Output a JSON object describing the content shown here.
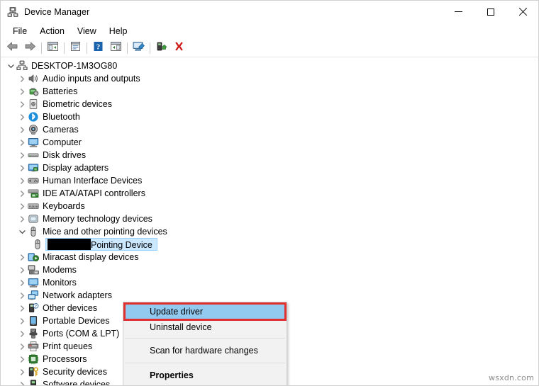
{
  "window": {
    "title": "Device Manager",
    "title_icon": "device-manager-icon",
    "controls": {
      "minimize": "minimize-icon",
      "maximize": "maximize-icon",
      "close": "close-icon"
    }
  },
  "menubar": {
    "items": [
      {
        "label": "File"
      },
      {
        "label": "Action"
      },
      {
        "label": "View"
      },
      {
        "label": "Help"
      }
    ]
  },
  "toolbar": {
    "buttons": [
      {
        "name": "back-icon"
      },
      {
        "name": "forward-icon"
      },
      {
        "name": "show-hide-console-tree-icon"
      },
      {
        "name": "properties-icon"
      },
      {
        "name": "help-icon"
      },
      {
        "name": "show-hide-action-pane-icon"
      },
      {
        "name": "scan-for-hardware-changes-icon"
      },
      {
        "name": "update-driver-icon"
      },
      {
        "name": "uninstall-device-icon"
      }
    ]
  },
  "tree": {
    "root": {
      "label": "DESKTOP-1M3OG80",
      "icon": "computer-root-icon",
      "expanded": true
    },
    "items": [
      {
        "label": "Audio inputs and outputs",
        "icon": "speaker-icon",
        "expanded": false
      },
      {
        "label": "Batteries",
        "icon": "battery-icon",
        "expanded": false
      },
      {
        "label": "Biometric devices",
        "icon": "fingerprint-icon",
        "expanded": false
      },
      {
        "label": "Bluetooth",
        "icon": "bluetooth-icon",
        "expanded": false
      },
      {
        "label": "Cameras",
        "icon": "camera-icon",
        "expanded": false
      },
      {
        "label": "Computer",
        "icon": "monitor-icon",
        "expanded": false
      },
      {
        "label": "Disk drives",
        "icon": "disk-drive-icon",
        "expanded": false
      },
      {
        "label": "Display adapters",
        "icon": "display-adapter-icon",
        "expanded": false
      },
      {
        "label": "Human Interface Devices",
        "icon": "hid-icon",
        "expanded": false
      },
      {
        "label": "IDE ATA/ATAPI controllers",
        "icon": "ide-controller-icon",
        "expanded": false
      },
      {
        "label": "Keyboards",
        "icon": "keyboard-icon",
        "expanded": false
      },
      {
        "label": "Memory technology devices",
        "icon": "memory-icon",
        "expanded": false
      },
      {
        "label": "Mice and other pointing devices",
        "icon": "mouse-icon",
        "expanded": true
      },
      {
        "label": "Miracast display devices",
        "icon": "miracast-icon",
        "expanded": false
      },
      {
        "label": "Modems",
        "icon": "modem-icon",
        "expanded": false
      },
      {
        "label": "Monitors",
        "icon": "monitor-icon",
        "expanded": false
      },
      {
        "label": "Network adapters",
        "icon": "network-adapter-icon",
        "expanded": false
      },
      {
        "label": "Other devices",
        "icon": "other-device-icon",
        "expanded": false
      },
      {
        "label": "Portable Devices",
        "icon": "portable-device-icon",
        "expanded": false
      },
      {
        "label": "Ports (COM & LPT)",
        "icon": "port-icon",
        "expanded": false
      },
      {
        "label": "Print queues",
        "icon": "printer-icon",
        "expanded": false
      },
      {
        "label": "Processors",
        "icon": "processor-icon",
        "expanded": false
      },
      {
        "label": "Security devices",
        "icon": "security-device-icon",
        "expanded": false
      },
      {
        "label": "Software devices",
        "icon": "software-device-icon",
        "expanded": false
      }
    ],
    "selected_child": {
      "label_suffix": "Pointing Device",
      "icon": "mouse-icon",
      "redacted": true,
      "selected": true
    }
  },
  "context_menu": {
    "items": [
      {
        "label": "Update driver",
        "highlighted": true,
        "bold": false
      },
      {
        "label": "Uninstall device",
        "highlighted": false,
        "bold": false
      },
      {
        "label": "Scan for hardware changes",
        "highlighted": false,
        "bold": false
      },
      {
        "label": "Properties",
        "highlighted": false,
        "bold": true
      }
    ]
  },
  "watermark": {
    "text": "wsxdn.com"
  },
  "colors": {
    "selection_blue": "#cce8ff",
    "menu_highlight": "#91c9ef",
    "highlight_border": "#e03030",
    "menu_bg": "#f2f2f2",
    "redaction": "#000000"
  }
}
